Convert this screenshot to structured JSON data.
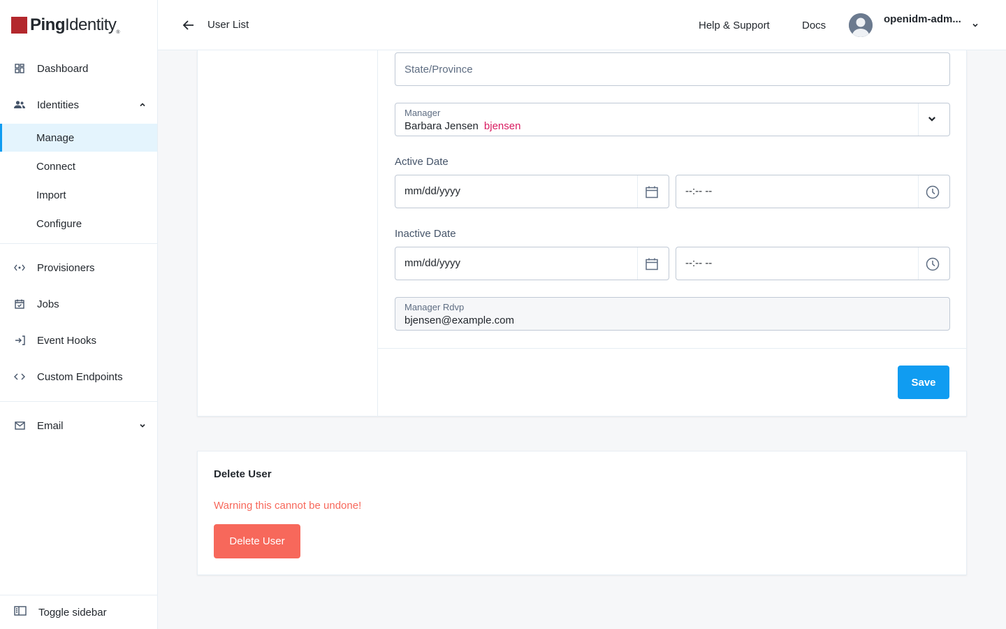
{
  "brand": {
    "logo_bold": "Ping",
    "logo_light": "Identity",
    "logo_reg": "®",
    "accent": "#109cf1",
    "danger": "#f7685b",
    "logo_color": "#b3282d"
  },
  "sidebar": {
    "dashboard": "Dashboard",
    "identities": "Identities",
    "sub": {
      "manage": "Manage",
      "connect": "Connect",
      "import": "Import",
      "configure": "Configure"
    },
    "provisioners": "Provisioners",
    "jobs": "Jobs",
    "event_hooks": "Event Hooks",
    "custom_endpoints": "Custom Endpoints",
    "email": "Email",
    "toggle": "Toggle sidebar"
  },
  "header": {
    "back_label": "User List",
    "help": "Help & Support",
    "docs": "Docs",
    "user": "openidm-adm..."
  },
  "form": {
    "state_placeholder": "State/Province",
    "manager": {
      "label": "Manager",
      "name": "Barbara Jensen",
      "username": "bjensen"
    },
    "active_date": {
      "label": "Active Date",
      "date": "mm/dd/yyyy",
      "time": "--:-- --"
    },
    "inactive_date": {
      "label": "Inactive Date",
      "date": "mm/dd/yyyy",
      "time": "--:-- --"
    },
    "manager_rdvp": {
      "label": "Manager Rdvp",
      "value": "bjensen@example.com"
    },
    "save": "Save"
  },
  "delete": {
    "title": "Delete User",
    "warning": "Warning this cannot be undone!",
    "button": "Delete User"
  }
}
